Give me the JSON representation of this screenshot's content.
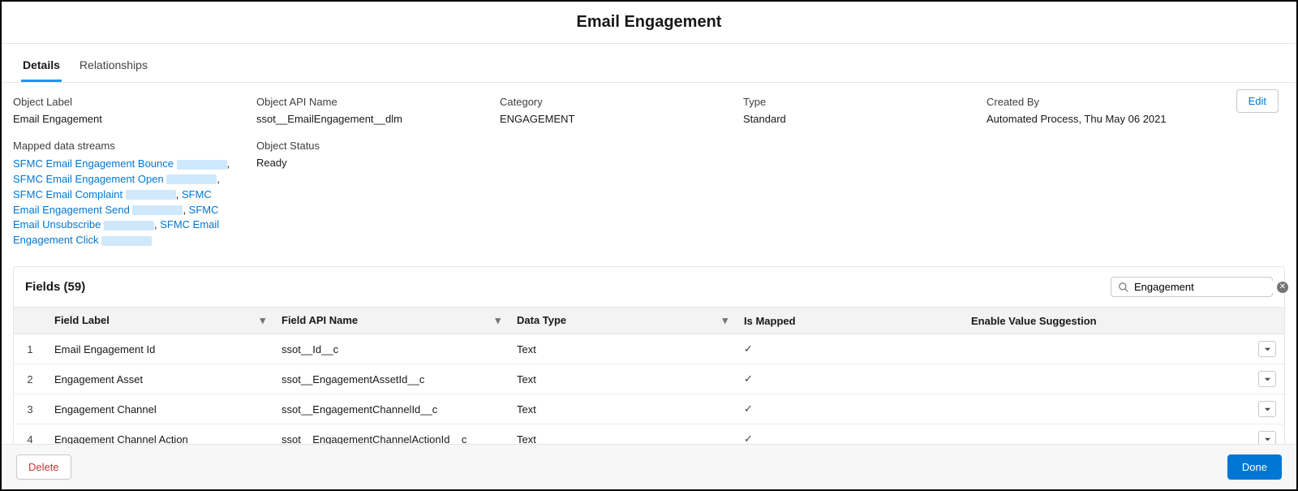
{
  "header": {
    "title": "Email Engagement"
  },
  "tabs": [
    {
      "label": "Details",
      "active": true
    },
    {
      "label": "Relationships",
      "active": false
    }
  ],
  "meta": {
    "object_label": {
      "label": "Object Label",
      "value": "Email Engagement"
    },
    "api_name": {
      "label": "Object API Name",
      "value": "ssot__EmailEngagement__dlm"
    },
    "category": {
      "label": "Category",
      "value": "ENGAGEMENT"
    },
    "type": {
      "label": "Type",
      "value": "Standard"
    },
    "created_by": {
      "label": "Created By",
      "value": "Automated Process, Thu May 06 2021"
    },
    "mapped_streams": {
      "label": "Mapped data streams",
      "items": [
        "SFMC Email Engagement Bounce",
        "SFMC Email Engagement Open",
        "SFMC Email Complaint",
        "SFMC Email Engagement Send",
        "SFMC Email Unsubscribe",
        "SFMC Email Engagement Click"
      ]
    },
    "object_status": {
      "label": "Object Status",
      "value": "Ready"
    }
  },
  "buttons": {
    "edit": "Edit",
    "delete": "Delete",
    "done": "Done"
  },
  "fields": {
    "title_prefix": "Fields",
    "count": 59,
    "search_value": "Engagement",
    "columns": {
      "field_label": "Field Label",
      "api_name": "Field API Name",
      "data_type": "Data Type",
      "is_mapped": "Is Mapped",
      "enable_value_suggestion": "Enable Value Suggestion"
    },
    "rows": [
      {
        "n": 1,
        "label": "Email Engagement Id",
        "api": "ssot__Id__c",
        "type": "Text",
        "mapped": true
      },
      {
        "n": 2,
        "label": "Engagement Asset",
        "api": "ssot__EngagementAssetId__c",
        "type": "Text",
        "mapped": true
      },
      {
        "n": 3,
        "label": "Engagement Channel",
        "api": "ssot__EngagementChannelId__c",
        "type": "Text",
        "mapped": true
      },
      {
        "n": 4,
        "label": "Engagement Channel Action",
        "api": "ssot__EngagementChannelActionId__c",
        "type": "Text",
        "mapped": true
      }
    ]
  }
}
